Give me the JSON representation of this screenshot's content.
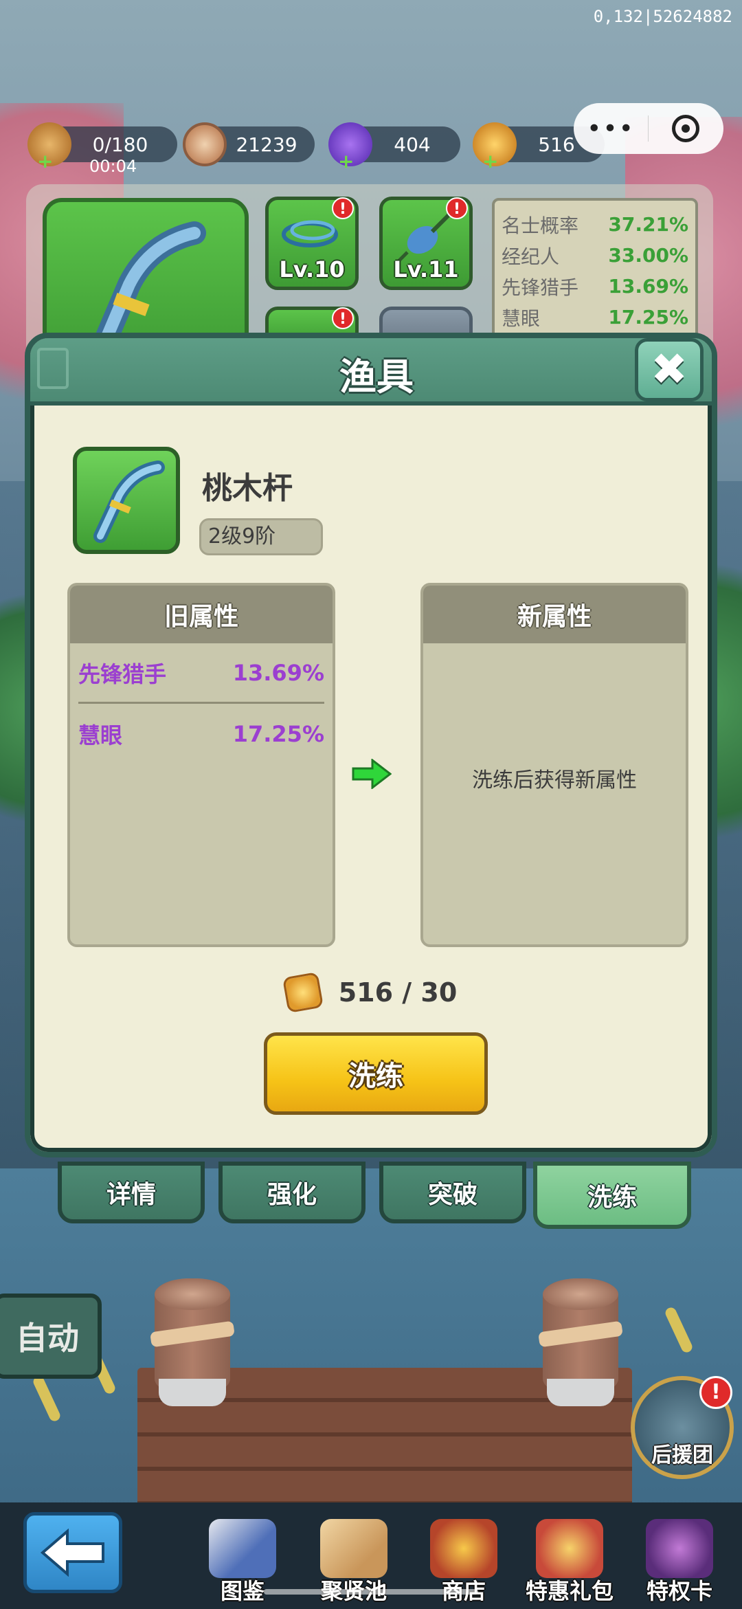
{
  "debug": {
    "text": "0,132|52624882"
  },
  "resources": [
    {
      "icon": "bread-icon",
      "value": "0/180"
    },
    {
      "icon": "coin-icon",
      "value": "21239"
    },
    {
      "icon": "gem-icon",
      "value": "404"
    },
    {
      "icon": "ticket-icon",
      "value": "516"
    }
  ],
  "timer": "00:04",
  "capsule": {
    "more": "•••"
  },
  "equipment": {
    "slots": [
      {
        "level": "Lv.10"
      },
      {
        "level": "Lv.11"
      }
    ],
    "stats": [
      {
        "name": "名士概率",
        "value": "37.21%"
      },
      {
        "name": "经纪人",
        "value": "33.00%"
      },
      {
        "name": "先锋猎手",
        "value": "13.69%"
      },
      {
        "name": "慧眼",
        "value": "17.25%"
      }
    ]
  },
  "modal": {
    "title": "渔具",
    "close": "✖",
    "item": {
      "name": "桃木杆",
      "grade": "2级9阶"
    },
    "old_attrs": {
      "title": "旧属性",
      "rows": [
        {
          "name": "先锋猎手",
          "value": "13.69%"
        },
        {
          "name": "慧眼",
          "value": "17.25%"
        }
      ]
    },
    "new_attrs": {
      "title": "新属性",
      "empty_text": "洗练后获得新属性"
    },
    "cost": "516 / 30",
    "refine_button": "洗练"
  },
  "tabs": [
    {
      "label": "详情"
    },
    {
      "label": "强化"
    },
    {
      "label": "突破"
    },
    {
      "label": "洗练",
      "active": true
    }
  ],
  "side": {
    "auto": "自动",
    "support": "后援团",
    "alert": "!"
  },
  "bottom_nav": [
    {
      "label": "图鉴",
      "icon": "book-icon"
    },
    {
      "label": "聚贤池",
      "icon": "map-icon"
    },
    {
      "label": "商店",
      "icon": "shop-icon"
    },
    {
      "label": "特惠礼包",
      "icon": "gift-icon"
    },
    {
      "label": "特权卡",
      "icon": "card-icon"
    }
  ],
  "colors": {
    "accent_green": "#3aa037",
    "attr_purple": "#9b3fd0",
    "panel_teal": "#4d8a74",
    "button_yellow": "#f6c317"
  }
}
